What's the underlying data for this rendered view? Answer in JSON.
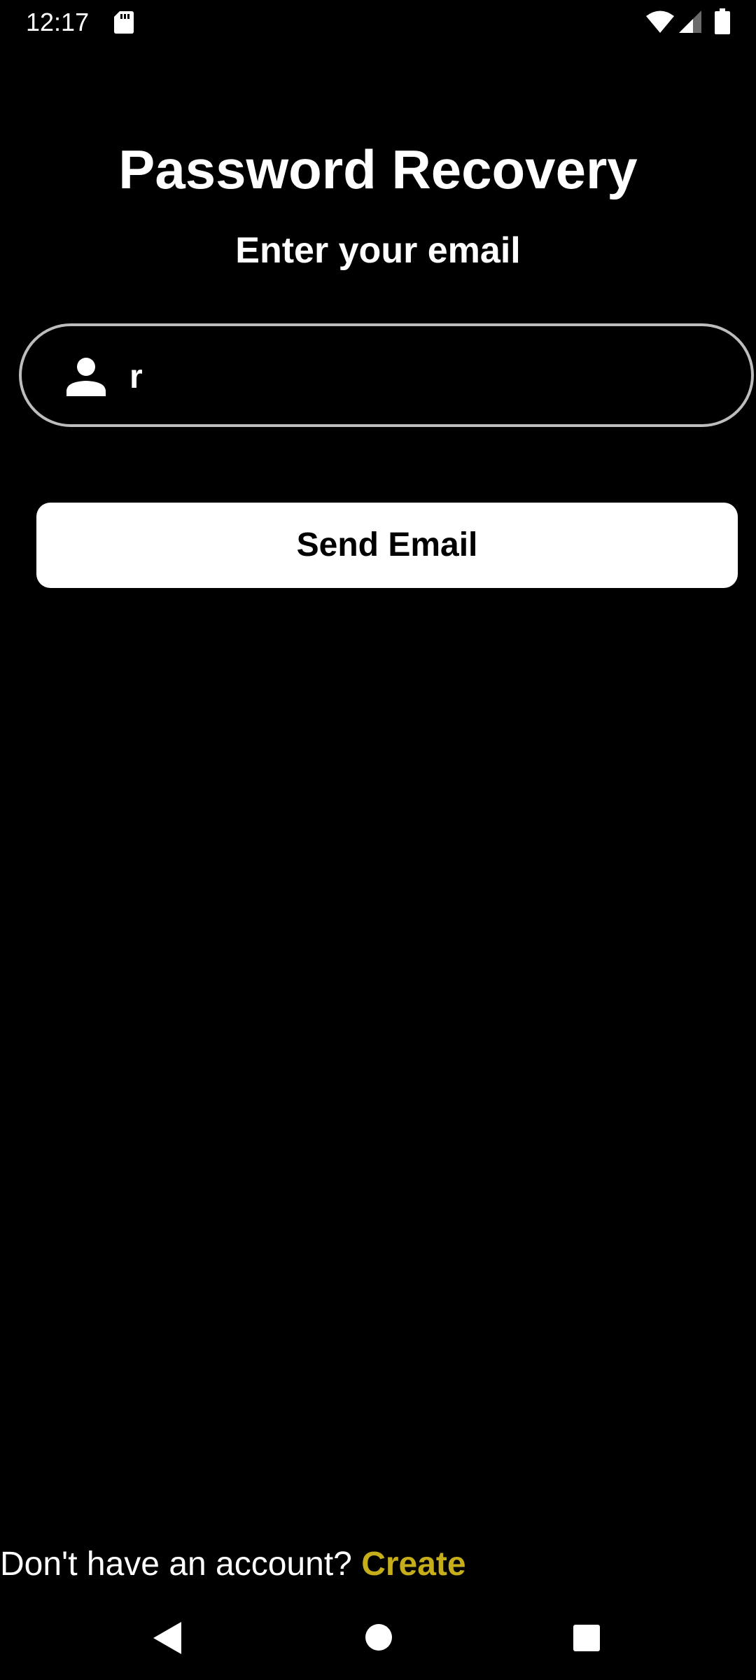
{
  "status_bar": {
    "time": "12:17",
    "icons": [
      "sd-card-icon",
      "wifi-icon",
      "signal-icon",
      "battery-icon"
    ]
  },
  "header": {
    "title": "Password Recovery",
    "subtitle": "Enter your email"
  },
  "form": {
    "email_value": "r",
    "field_icon": "person-icon",
    "send_label": "Send Email"
  },
  "footer": {
    "prompt": "Don't have an account? ",
    "link_label": "Create"
  },
  "nav_bar": {
    "icons": [
      "back-icon",
      "home-icon",
      "recents-icon"
    ]
  },
  "colors": {
    "background": "#000000",
    "text": "#ffffff",
    "accent": "#c6ad1a",
    "button_background": "#ffffff",
    "field_border": "#bdbdbd"
  }
}
